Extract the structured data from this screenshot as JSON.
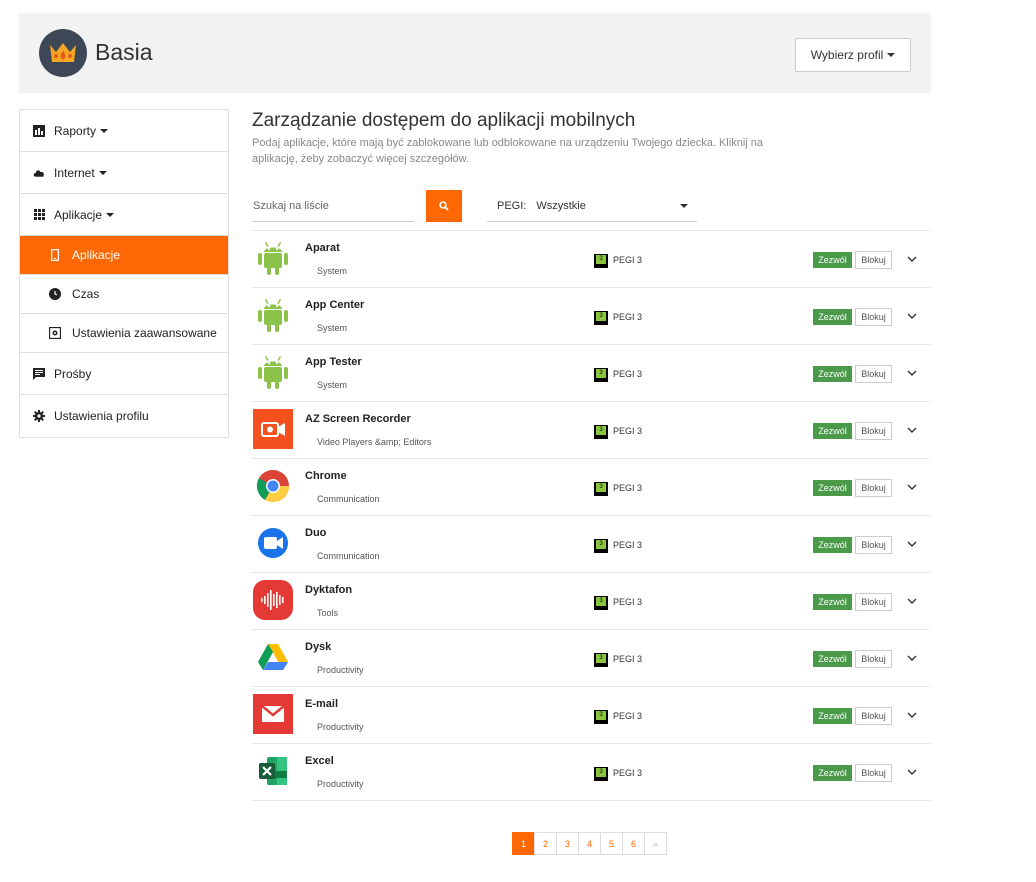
{
  "header": {
    "profile_name": "Basia",
    "profile_button": "Wybierz profil"
  },
  "sidebar": {
    "items": [
      {
        "label": "Raporty",
        "icon": "bar-chart-icon"
      },
      {
        "label": "Internet",
        "icon": "cloud-icon"
      },
      {
        "label": "Aplikacje",
        "icon": "grid-icon"
      },
      {
        "label": "Aplikacje",
        "icon": "phone-icon",
        "active": true
      },
      {
        "label": "Czas",
        "icon": "clock-icon"
      },
      {
        "label": "Ustawienia zaawansowane",
        "icon": "settings-box-icon"
      },
      {
        "label": "Prośby",
        "icon": "message-icon"
      },
      {
        "label": "Ustawienia profilu",
        "icon": "gear-icon"
      }
    ]
  },
  "main": {
    "title": "Zarządzanie dostępem do aplikacji mobilnych",
    "description": "Podaj aplikacje, które mają być zablokowane lub odblokowane na urządzeniu Twojego dziecka. Kliknij na aplikację, żeby zobaczyć więcej szczegółów.",
    "search_placeholder": "Szukaj na liście",
    "pegi_label": "PEGI:",
    "pegi_value": "Wszystkie"
  },
  "apps": [
    {
      "name": "Aparat",
      "category": "System",
      "pegi": "PEGI 3",
      "allow": "Zezwól",
      "block": "Blokuj",
      "icon": "android-icon"
    },
    {
      "name": "App Center",
      "category": "System",
      "pegi": "PEGI 3",
      "allow": "Zezwól",
      "block": "Blokuj",
      "icon": "android-icon"
    },
    {
      "name": "App Tester",
      "category": "System",
      "pegi": "PEGI 3",
      "allow": "Zezwól",
      "block": "Blokuj",
      "icon": "android-icon"
    },
    {
      "name": "AZ Screen Recorder",
      "category": "Video Players &amp; Editors",
      "pegi": "PEGI 3",
      "allow": "Zezwól",
      "block": "Blokuj",
      "icon": "screen-recorder-icon"
    },
    {
      "name": "Chrome",
      "category": "Communication",
      "pegi": "PEGI 3",
      "allow": "Zezwól",
      "block": "Blokuj",
      "icon": "chrome-icon"
    },
    {
      "name": "Duo",
      "category": "Communication",
      "pegi": "PEGI 3",
      "allow": "Zezwól",
      "block": "Blokuj",
      "icon": "duo-icon"
    },
    {
      "name": "Dyktafon",
      "category": "Tools",
      "pegi": "PEGI 3",
      "allow": "Zezwól",
      "block": "Blokuj",
      "icon": "voice-recorder-icon"
    },
    {
      "name": "Dysk",
      "category": "Productivity",
      "pegi": "PEGI 3",
      "allow": "Zezwól",
      "block": "Blokuj",
      "icon": "drive-icon"
    },
    {
      "name": "E-mail",
      "category": "Productivity",
      "pegi": "PEGI 3",
      "allow": "Zezwól",
      "block": "Blokuj",
      "icon": "email-icon"
    },
    {
      "name": "Excel",
      "category": "Productivity",
      "pegi": "PEGI 3",
      "allow": "Zezwól",
      "block": "Blokuj",
      "icon": "excel-icon"
    }
  ],
  "pegi_badge_digit": "3",
  "pagination": [
    "1",
    "2",
    "3",
    "4",
    "5",
    "6",
    "»"
  ],
  "colors": {
    "accent": "#fe6804",
    "allow_button": "#4a9a4a",
    "header_bg": "#f2f2f2",
    "pegi_green": "#8ac53e"
  }
}
